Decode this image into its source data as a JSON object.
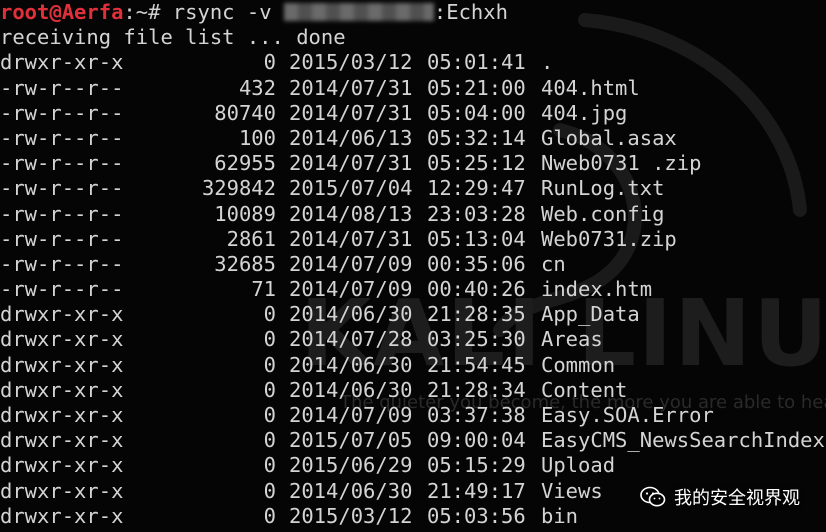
{
  "prompt": {
    "user_host": "root@Aerfa",
    "path_sep": ":~# ",
    "command_start": "rsync -v ",
    "command_end": ":Echxh"
  },
  "status_line": "receiving file list ... done",
  "files": [
    {
      "perm": "drwxr-xr-x",
      "size": "0",
      "date": "2015/03/12",
      "time": "05:01:41",
      "name": "."
    },
    {
      "perm": "-rw-r--r--",
      "size": "432",
      "date": "2014/07/31",
      "time": "05:21:00",
      "name": "404.html"
    },
    {
      "perm": "-rw-r--r--",
      "size": "80740",
      "date": "2014/07/31",
      "time": "05:04:00",
      "name": "404.jpg"
    },
    {
      "perm": "-rw-r--r--",
      "size": "100",
      "date": "2014/06/13",
      "time": "05:32:14",
      "name": "Global.asax"
    },
    {
      "perm": "-rw-r--r--",
      "size": "62955",
      "date": "2014/07/31",
      "time": "05:25:12",
      "name": "Nweb0731 .zip"
    },
    {
      "perm": "-rw-r--r--",
      "size": "329842",
      "date": "2015/07/04",
      "time": "12:29:47",
      "name": "RunLog.txt"
    },
    {
      "perm": "-rw-r--r--",
      "size": "10089",
      "date": "2014/08/13",
      "time": "23:03:28",
      "name": "Web.config"
    },
    {
      "perm": "-rw-r--r--",
      "size": "2861",
      "date": "2014/07/31",
      "time": "05:13:04",
      "name": "Web0731.zip"
    },
    {
      "perm": "-rw-r--r--",
      "size": "32685",
      "date": "2014/07/09",
      "time": "00:35:06",
      "name": "cn"
    },
    {
      "perm": "-rw-r--r--",
      "size": "71",
      "date": "2014/07/09",
      "time": "00:40:26",
      "name": "index.htm"
    },
    {
      "perm": "drwxr-xr-x",
      "size": "0",
      "date": "2014/06/30",
      "time": "21:28:35",
      "name": "App_Data"
    },
    {
      "perm": "drwxr-xr-x",
      "size": "0",
      "date": "2014/07/28",
      "time": "03:25:30",
      "name": "Areas"
    },
    {
      "perm": "drwxr-xr-x",
      "size": "0",
      "date": "2014/06/30",
      "time": "21:54:45",
      "name": "Common"
    },
    {
      "perm": "drwxr-xr-x",
      "size": "0",
      "date": "2014/06/30",
      "time": "21:28:34",
      "name": "Content"
    },
    {
      "perm": "drwxr-xr-x",
      "size": "0",
      "date": "2014/07/09",
      "time": "03:37:38",
      "name": "Easy.SOA.Error"
    },
    {
      "perm": "drwxr-xr-x",
      "size": "0",
      "date": "2015/07/05",
      "time": "09:00:04",
      "name": "EasyCMS_NewsSearchIndex"
    },
    {
      "perm": "drwxr-xr-x",
      "size": "0",
      "date": "2015/06/29",
      "time": "05:15:29",
      "name": "Upload"
    },
    {
      "perm": "drwxr-xr-x",
      "size": "0",
      "date": "2014/06/30",
      "time": "21:49:17",
      "name": "Views"
    },
    {
      "perm": "drwxr-xr-x",
      "size": "0",
      "date": "2015/03/12",
      "time": "05:03:56",
      "name": "bin"
    }
  ],
  "watermark": {
    "logo_text": "KALI LINUX",
    "tagline": "The quieter you become, the more you are able to hear"
  },
  "badge": {
    "label": "我的安全视界观",
    "icon": "wechat-icon"
  },
  "colors": {
    "background": "#050505",
    "text": "#d4d4d4",
    "prompt_user": "#e0313a"
  }
}
